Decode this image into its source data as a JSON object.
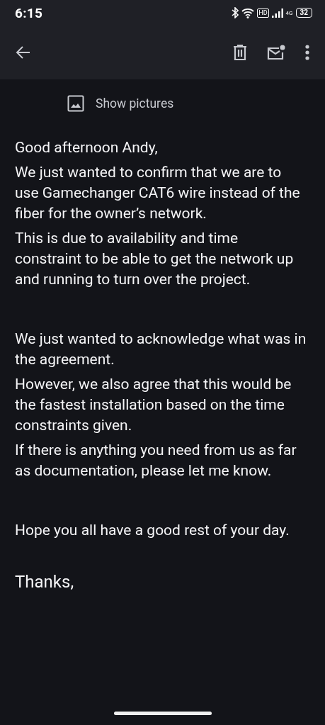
{
  "status_bar": {
    "time": "6:15",
    "network": "4G",
    "hd": "HD",
    "battery": "32"
  },
  "show_pictures": {
    "label": "Show pictures"
  },
  "message": {
    "paragraphs": [
      {
        "kind": "text",
        "text": "Good afternoon Andy,"
      },
      {
        "kind": "text",
        "text": "We just wanted to confirm that we are to use Gamechanger CAT6 wire instead of the fiber for the owner’s network."
      },
      {
        "kind": "text",
        "text": "This is due to availability and time constraint to be able to get the network up and running to turn over the project."
      },
      {
        "kind": "text_after_gap",
        "text": "We just wanted to acknowledge what was in the agreement."
      },
      {
        "kind": "text",
        "text": "However, we also agree that this would be the fastest installation based on the time constraints given."
      },
      {
        "kind": "text",
        "text": "If there is anything you need from us as far as documentation, please let me know."
      },
      {
        "kind": "text_after_gap",
        "text": "Hope you all have a good rest of your day."
      },
      {
        "kind": "signoff",
        "text": "Thanks,"
      }
    ]
  }
}
